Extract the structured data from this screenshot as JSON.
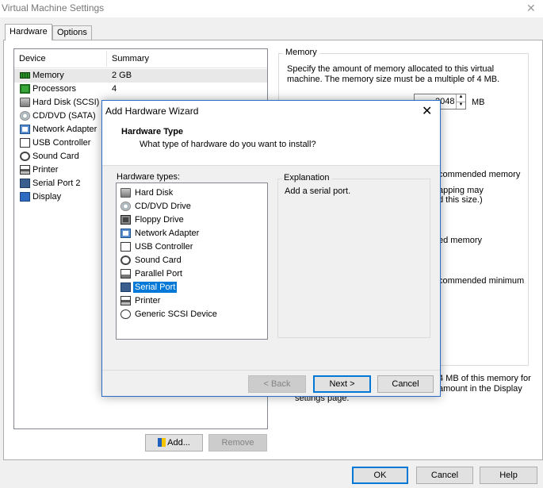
{
  "window": {
    "title": "Virtual Machine Settings",
    "close": "✕"
  },
  "tabs": [
    {
      "label": "Hardware"
    },
    {
      "label": "Options"
    }
  ],
  "device_list": {
    "headers": {
      "device": "Device",
      "summary": "Summary"
    },
    "rows": [
      {
        "icon": "memory-icon",
        "name": "Memory",
        "summary": "2 GB"
      },
      {
        "icon": "processor-icon",
        "name": "Processors",
        "summary": "4"
      },
      {
        "icon": "hard-disk-icon",
        "name": "Hard Disk (SCSI)",
        "summary": ""
      },
      {
        "icon": "cd-dvd-icon",
        "name": "CD/DVD (SATA)",
        "summary": ""
      },
      {
        "icon": "network-adapter-icon",
        "name": "Network Adapter",
        "summary": ""
      },
      {
        "icon": "usb-controller-icon",
        "name": "USB Controller",
        "summary": ""
      },
      {
        "icon": "sound-card-icon",
        "name": "Sound Card",
        "summary": ""
      },
      {
        "icon": "printer-icon",
        "name": "Printer",
        "summary": ""
      },
      {
        "icon": "serial-port-icon",
        "name": "Serial Port 2",
        "summary": ""
      },
      {
        "icon": "display-icon",
        "name": "Display",
        "summary": ""
      }
    ],
    "add_button": "Add...",
    "remove_button": "Remove"
  },
  "memory_panel": {
    "legend": "Memory",
    "desc_line1": "Specify the amount of memory allocated to this virtual",
    "desc_line2": "machine. The memory size must be a multiple of 4 MB.",
    "value": "2048",
    "unit": "MB",
    "frag_recommended": "commended memory",
    "frag_swapping1": "apping may",
    "frag_swapping2": "d this size.)",
    "frag_guest": "ed memory",
    "frag_minimum": "commended minimum",
    "note_line1": "4 MB of this memory for",
    "note_line2": "amount in the Display",
    "note_line3": "settings page."
  },
  "wizard": {
    "title": "Add Hardware Wizard",
    "close": "✕",
    "heading": "Hardware Type",
    "subheading": "What type of hardware do you want to install?",
    "types_label": "Hardware types:",
    "types": [
      {
        "icon": "hard-disk-icon",
        "name": "Hard Disk"
      },
      {
        "icon": "cd-dvd-icon",
        "name": "CD/DVD Drive"
      },
      {
        "icon": "floppy-icon",
        "name": "Floppy Drive"
      },
      {
        "icon": "network-adapter-icon",
        "name": "Network Adapter"
      },
      {
        "icon": "usb-controller-icon",
        "name": "USB Controller"
      },
      {
        "icon": "sound-card-icon",
        "name": "Sound Card"
      },
      {
        "icon": "parallel-port-icon",
        "name": "Parallel Port"
      },
      {
        "icon": "serial-port-icon",
        "name": "Serial Port"
      },
      {
        "icon": "printer-icon",
        "name": "Printer"
      },
      {
        "icon": "scsi-device-icon",
        "name": "Generic SCSI Device"
      }
    ],
    "selected_type": "Serial Port",
    "explanation_label": "Explanation",
    "explanation_text": "Add a serial port.",
    "back_button": "< Back",
    "next_button": "Next >",
    "cancel_button": "Cancel"
  },
  "footer": {
    "ok": "OK",
    "cancel": "Cancel",
    "help": "Help"
  },
  "colors": {
    "selection": "#0078d7",
    "accent_border": "#0078d7"
  }
}
